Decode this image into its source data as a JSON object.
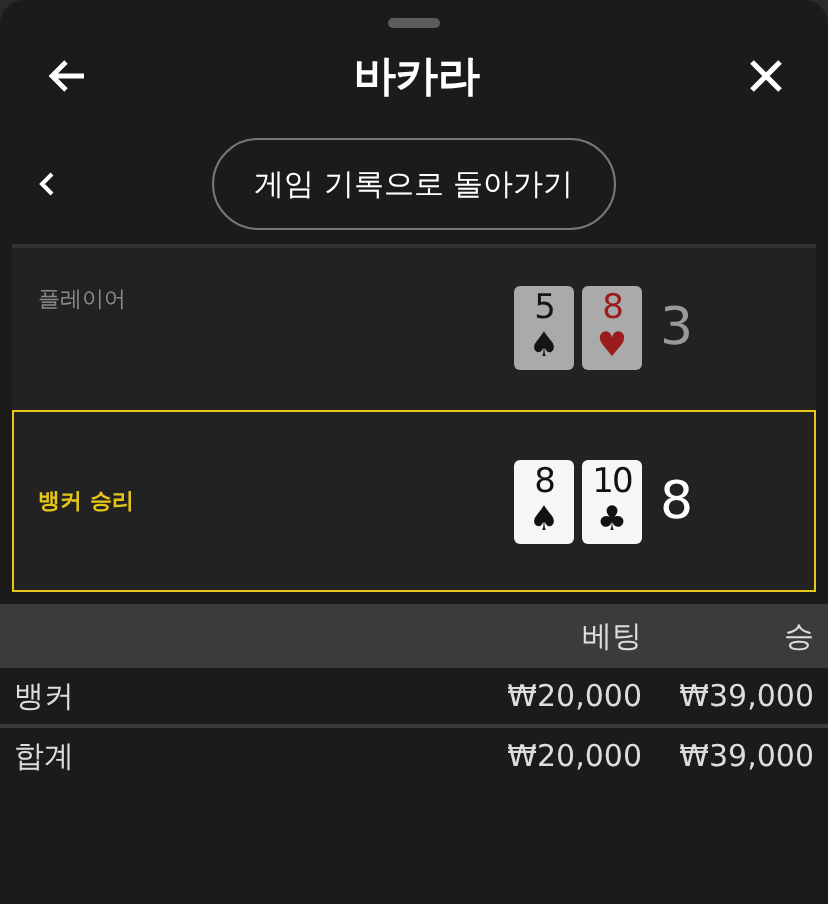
{
  "window": {
    "title": "바카라"
  },
  "back_button": {
    "label": "게임 기록으로 돌아가기"
  },
  "hands": [
    {
      "label": "플레이어",
      "winner": false,
      "total": "3",
      "cards": [
        {
          "rank": "5",
          "suit": "♠",
          "red": false
        },
        {
          "rank": "8",
          "suit": "♥",
          "red": true
        }
      ]
    },
    {
      "label": "뱅커 승리",
      "winner": true,
      "total": "8",
      "cards": [
        {
          "rank": "8",
          "suit": "♠",
          "red": false
        },
        {
          "rank": "10",
          "suit": "♣",
          "red": false
        }
      ]
    }
  ],
  "table": {
    "columns": [
      "",
      "베팅",
      "승"
    ],
    "rows": [
      {
        "cells": [
          "뱅커",
          "₩20,000",
          "₩39,000"
        ]
      },
      {
        "cells": [
          "합계",
          "₩20,000",
          "₩39,000"
        ]
      }
    ]
  }
}
